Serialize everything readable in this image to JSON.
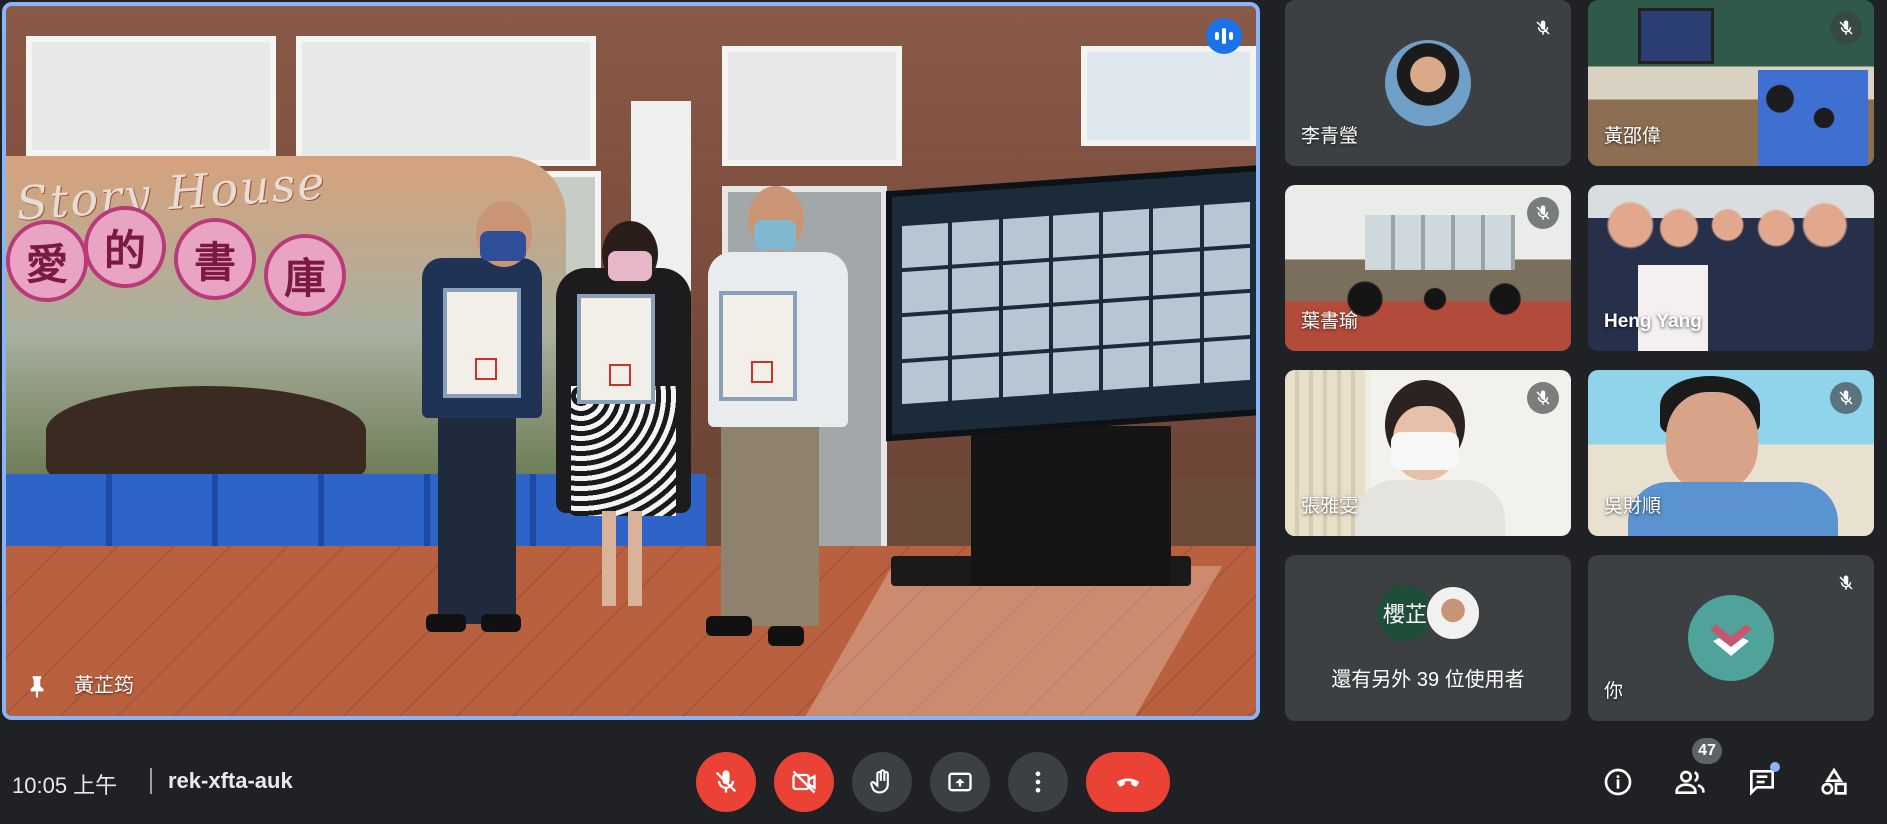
{
  "main": {
    "speaker_name": "黃芷筠",
    "mural_text": "Story House",
    "hearts": [
      "愛",
      "的",
      "書",
      "庫"
    ]
  },
  "participants": [
    {
      "name": "李青瑩",
      "type": "avatar-photo"
    },
    {
      "name": "黃邵偉",
      "type": "video"
    },
    {
      "name": "葉書瑜",
      "type": "video"
    },
    {
      "name": "Heng Yang",
      "type": "video"
    },
    {
      "name": "張雅雯",
      "type": "video"
    },
    {
      "name": "吳財順",
      "type": "video"
    }
  ],
  "others": {
    "avatar_text": "櫻芷",
    "label": "還有另外 39 位使用者"
  },
  "self": {
    "name": "你"
  },
  "bar": {
    "time": "10:05 上午",
    "meeting_code": "rek-xfta-auk",
    "people_count": "47"
  },
  "colors": {
    "background": "#202124",
    "tile": "#3c4043",
    "red": "#ea4335",
    "accent": "#8ab4f8",
    "speaking": "#1a73e8"
  },
  "icons": [
    "mic-off-icon",
    "camera-off-icon",
    "hand-icon",
    "present-icon",
    "more-icon",
    "end-call-icon",
    "info-icon",
    "people-icon",
    "chat-icon",
    "activities-icon",
    "pin-icon",
    "speaking-icon"
  ]
}
